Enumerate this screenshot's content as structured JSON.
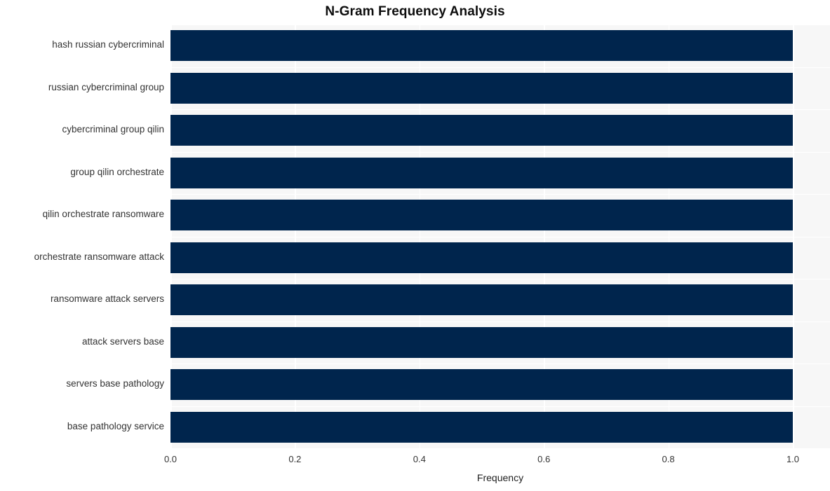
{
  "chart_data": {
    "type": "bar",
    "orientation": "horizontal",
    "title": "N-Gram Frequency Analysis",
    "xlabel": "Frequency",
    "ylabel": "",
    "categories": [
      "hash russian cybercriminal",
      "russian cybercriminal group",
      "cybercriminal group qilin",
      "group qilin orchestrate",
      "qilin orchestrate ransomware",
      "orchestrate ransomware attack",
      "ransomware attack servers",
      "attack servers base",
      "servers base pathology",
      "base pathology service"
    ],
    "values": [
      1.0,
      1.0,
      1.0,
      1.0,
      1.0,
      1.0,
      1.0,
      1.0,
      1.0,
      1.0
    ],
    "xticks": [
      "0.0",
      "0.2",
      "0.4",
      "0.6",
      "0.8",
      "1.0"
    ],
    "xtick_values": [
      0.0,
      0.2,
      0.4,
      0.6,
      0.8,
      1.0
    ],
    "xlim": [
      0.0,
      1.0
    ],
    "grid": true,
    "legend": false,
    "bar_color": "#00254d",
    "plot_background": "#f7f7f7",
    "gridline_color": "#ffffff",
    "text_color": "#333333"
  }
}
